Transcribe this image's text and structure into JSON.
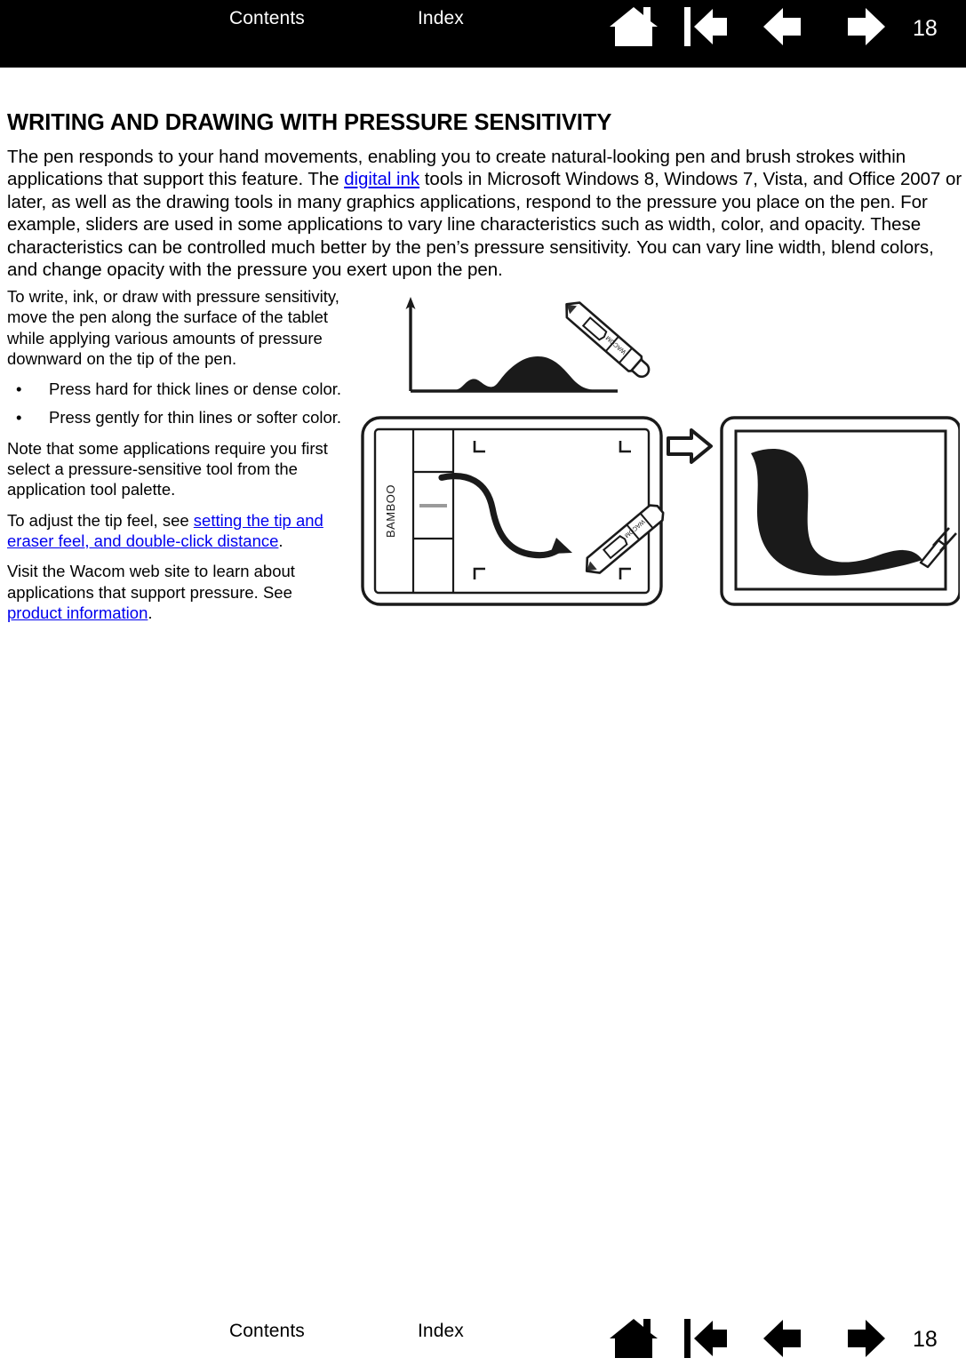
{
  "header": {
    "contents_label": "Contents",
    "index_label": "Index",
    "page_number": "18",
    "icons": [
      "home-icon",
      "first-page-icon",
      "previous-page-icon",
      "next-page-icon"
    ],
    "background_color": "#000000",
    "text_color": "#ffffff"
  },
  "footer": {
    "contents_label": "Contents",
    "index_label": "Index",
    "page_number": "18",
    "icons": [
      "home-icon",
      "first-page-icon",
      "previous-page-icon",
      "next-page-icon"
    ],
    "background_color": "#ffffff",
    "text_color": "#000000"
  },
  "content": {
    "title": "WRITING AND DRAWING WITH PRESSURE SENSITIVITY",
    "intro": {
      "part1": "The pen responds to your hand movements, enabling you to create natural-looking pen and brush strokes within applications that support this feature. The ",
      "link1": "digital ink",
      "part2": " tools in Microsoft Windows 8, Windows 7, Vista, and Office 2007 or later, as well as the drawing tools in many graphics applications, respond to the pressure you place on the pen. For example, sliders are used in some applications to vary line characteristics such as width, color, and opacity. These characteristics can be controlled much better by the pen’s pressure sensitivity. You can vary line width, blend colors, and change opacity with the pressure you exert upon the pen."
    },
    "left_column": {
      "intro_paragraph": "To write, ink, or draw with pressure sensitivity, move the pen along the surface of the tablet while applying various amounts of pressure downward on the tip of the pen.",
      "bullet_char": "•",
      "bullets": [
        "Press hard for thick lines or dense color.",
        "Press gently for thin lines or softer color."
      ],
      "note_paragraph": "Note that some applications require you first select a pressure-sensitive tool from the application tool palette.",
      "tip_feel": {
        "prefix": "To adjust the tip feel, see ",
        "link": "setting the tip and eraser feel, and double-click distance",
        "suffix": "."
      },
      "wacom_site": {
        "prefix": "Visit the Wacom web site to learn about applications that support pressure. See ",
        "link": "product information",
        "suffix": "."
      }
    },
    "link_color": "#0000ee"
  },
  "illustration": {
    "name": "pressure-sensitivity-diagram",
    "pressure_graph": {
      "name": "pressure-curve-graph",
      "description": "Vertical arrow axis with baseline and a filled pressure curve showing a small bump then a larger bump, with a stylus pen touching the end of the curve."
    },
    "tablet": {
      "name": "bamboo-tablet",
      "logo_text": "BAMBOO",
      "description": "Bamboo pen tablet with ExpressKeys on the left, active area with corner marks, and a stylus drawing a curved stroke ending in an arrowhead."
    },
    "transfer_arrow": {
      "name": "transfer-arrow-icon",
      "description": "Outlined right-pointing arrow between tablet and screen."
    },
    "screen": {
      "name": "screen-output",
      "description": "Monitor frame showing the resulting variable-width brush stroke drawn with a brush tip."
    }
  }
}
